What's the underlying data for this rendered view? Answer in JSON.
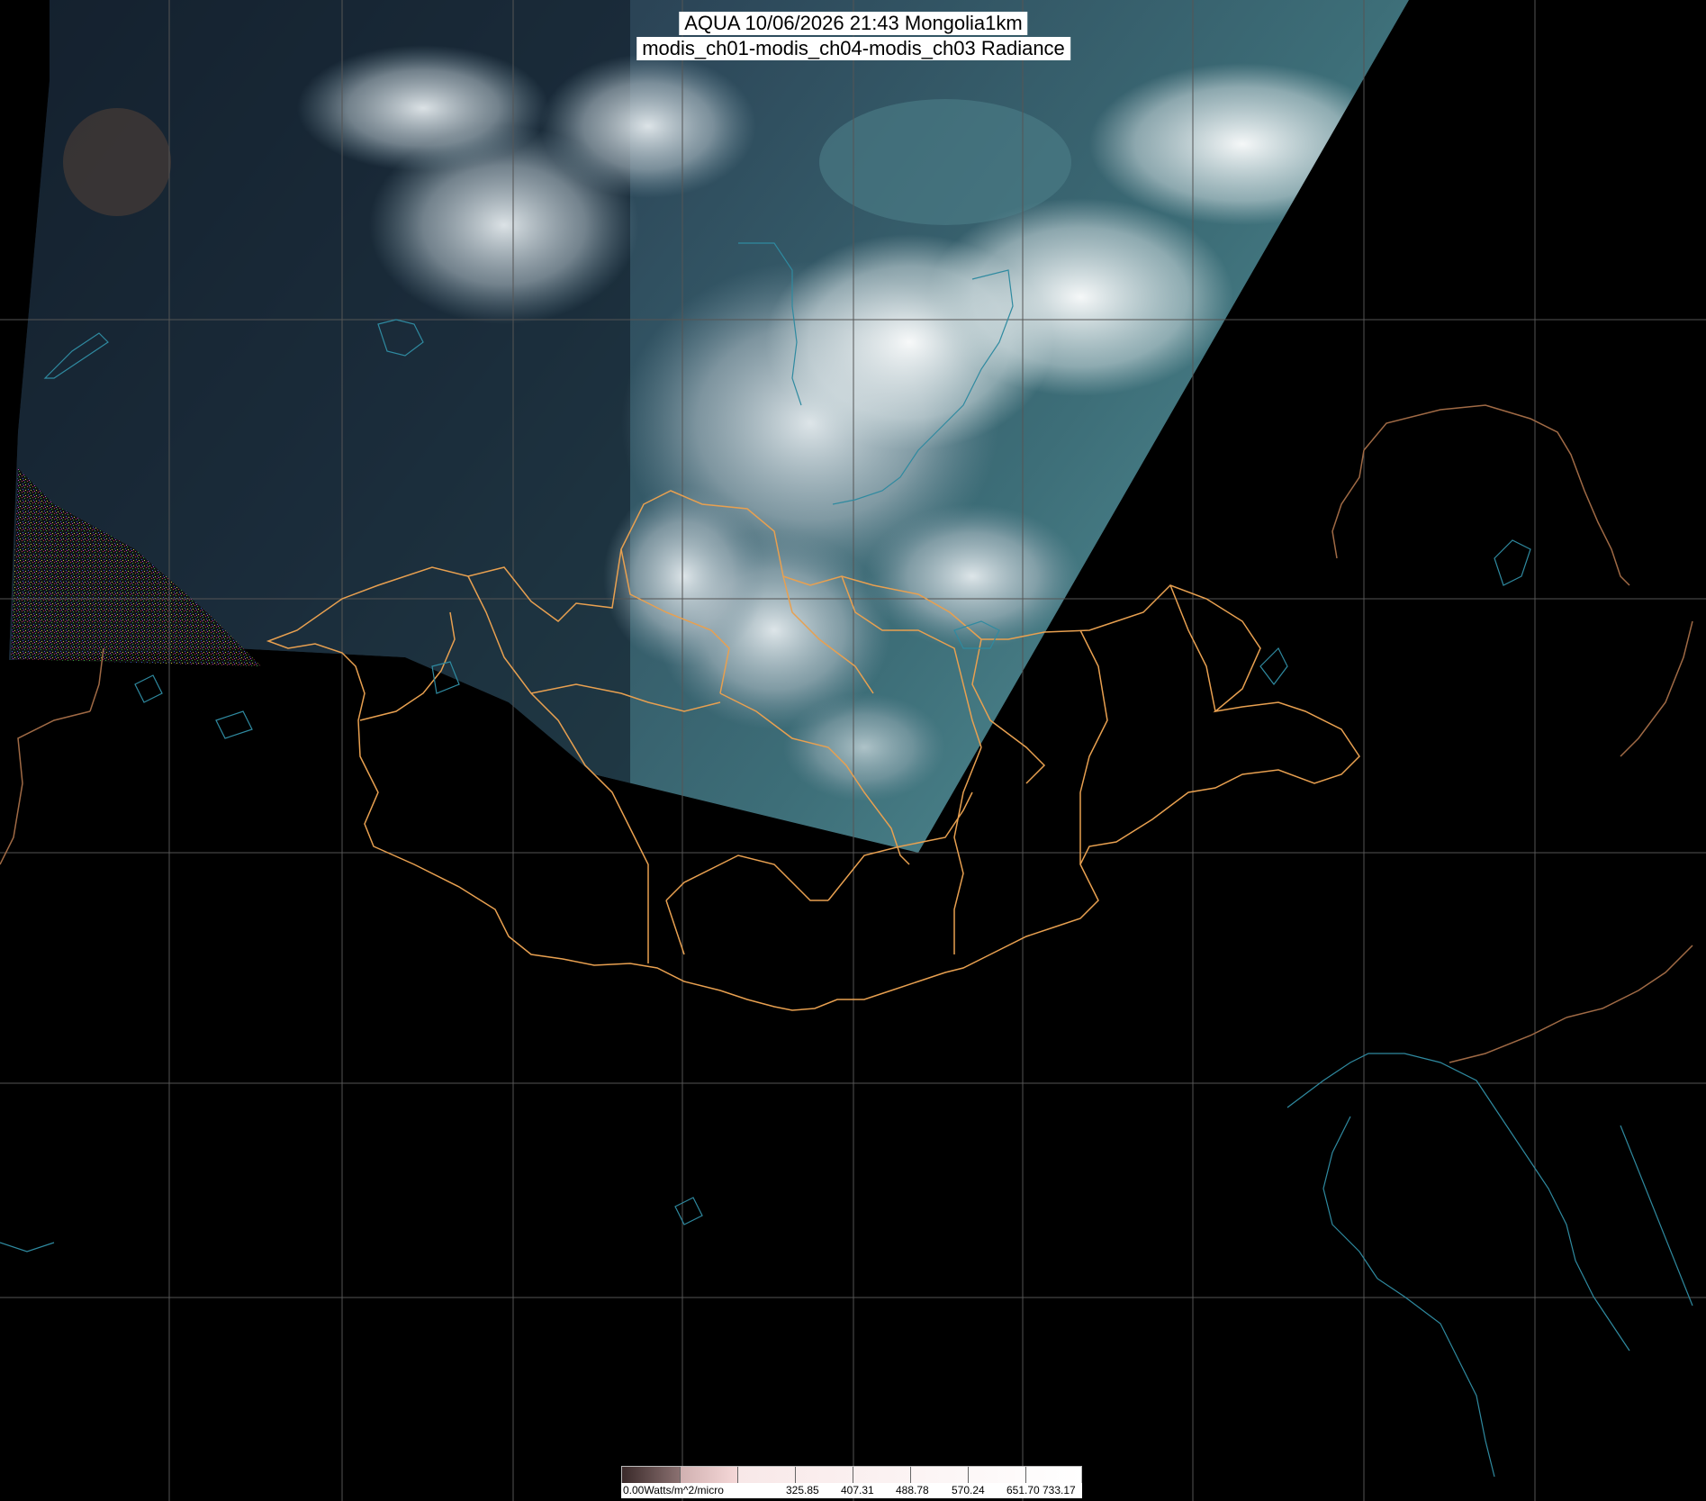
{
  "title": {
    "line1": "AQUA 10/06/2026 21:43 Mongolia1km",
    "line2": "modis_ch01-modis_ch04-modis_ch03 Radiance"
  },
  "colorbar": {
    "labels": [
      "0.00Watts/m^2/micro",
      "325.85",
      "407.31",
      "488.78",
      "570.24",
      "651.70",
      "733.17"
    ],
    "colors": [
      "#4a3a3a",
      "#a08a8a",
      "#f3d9d9",
      "#ffffff"
    ]
  },
  "colors": {
    "background": "#000000",
    "grid": "#555555",
    "province_borders": "#e8a050",
    "coastlines": "#2f8aa0",
    "country_borders": "#b07a50"
  }
}
